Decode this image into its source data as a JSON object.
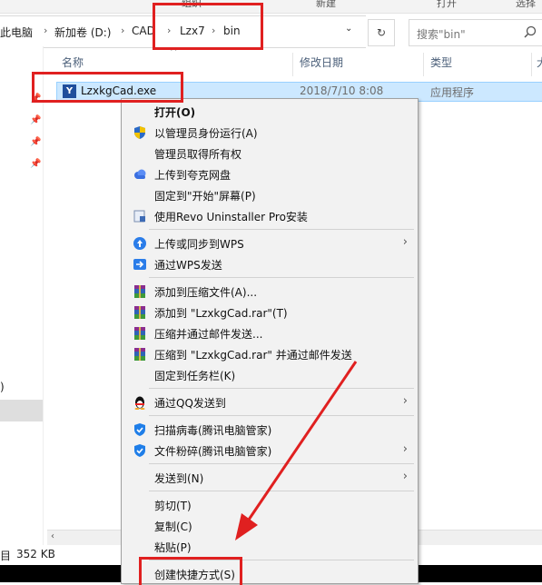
{
  "top_strip": {
    "col1": "组织",
    "col2": "新建",
    "col3": "打开",
    "col4": "选择"
  },
  "address": {
    "crumbs": [
      "此电脑",
      "新加卷 (D:)",
      "CAD",
      "Lzx7",
      "bin"
    ],
    "dropdown_icon": "chevron-down-icon",
    "refresh_icon": "refresh-icon"
  },
  "search": {
    "placeholder": "搜索\"bin\"",
    "icon": "search-icon"
  },
  "columns": {
    "name": "名称",
    "date": "修改日期",
    "type": "类型",
    "size": "大"
  },
  "file": {
    "name": "LzxkgCad.exe",
    "date": "2018/7/10 8:08",
    "type": "应用程序"
  },
  "nav": {
    "partial_label": ")"
  },
  "status": {
    "count": "目",
    "size": "352 KB"
  },
  "context_menu": {
    "open": "打开(O)",
    "run_as_admin": "以管理员身份运行(A)",
    "take_ownership": "管理员取得所有权",
    "upload_kuake": "上传到夸克网盘",
    "pin_start": "固定到\"开始\"屏幕(P)",
    "revo": "使用Revo Uninstaller Pro安装",
    "wps_sync": "上传或同步到WPS",
    "wps_send": "通过WPS发送",
    "add_archive": "添加到压缩文件(A)...",
    "add_rar": "添加到 \"LzxkgCad.rar\"(T)",
    "compress_email": "压缩并通过邮件发送...",
    "compress_rar_email": "压缩到 \"LzxkgCad.rar\" 并通过邮件发送",
    "pin_taskbar": "固定到任务栏(K)",
    "qq_send": "通过QQ发送到",
    "scan_virus": "扫描病毒(腾讯电脑管家)",
    "shred": "文件粉碎(腾讯电脑管家)",
    "send_to": "发送到(N)",
    "cut": "剪切(T)",
    "copy": "复制(C)",
    "paste": "粘贴(P)",
    "create_shortcut": "创建快捷方式(S)"
  },
  "annotation_color": "#e02020"
}
